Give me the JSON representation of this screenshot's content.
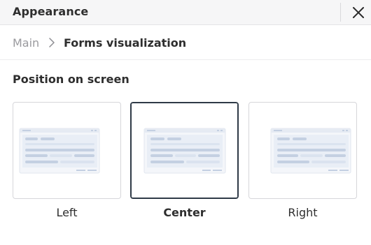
{
  "header": {
    "title": "Appearance",
    "close_icon": "close-icon"
  },
  "breadcrumb": {
    "main": "Main",
    "separator_icon": "chevron-right-icon",
    "current": "Forms visualization"
  },
  "section": {
    "title": "Position on screen"
  },
  "options": [
    {
      "label": "Left",
      "selected": false
    },
    {
      "label": "Center",
      "selected": true
    },
    {
      "label": "Right",
      "selected": false
    }
  ],
  "colors": {
    "selected_border": "#2f3a47",
    "preview_frame": "#e6ebf3",
    "preview_bar": "#c4d0e2",
    "preview_block": "#dbe3ef"
  }
}
